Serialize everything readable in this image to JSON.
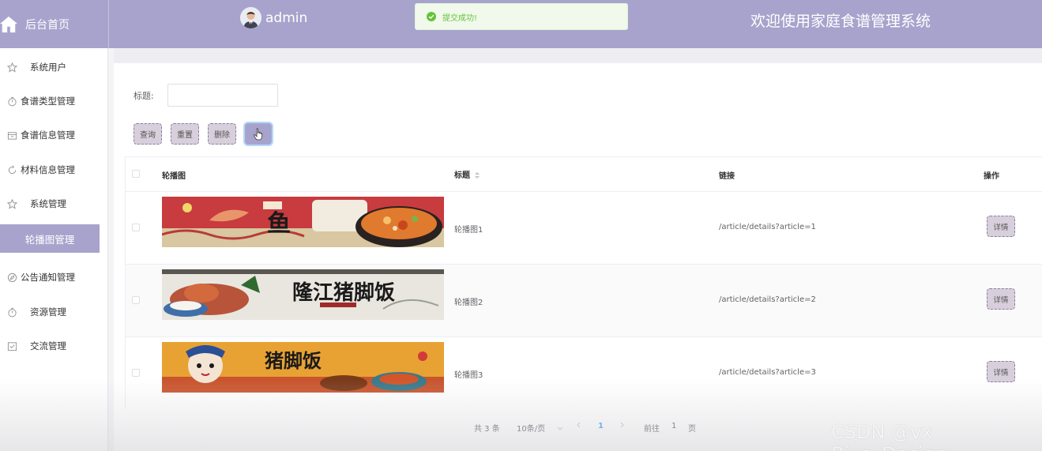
{
  "header": {
    "home_label": "后台首页",
    "user_name": "admin",
    "toast_message": "提交成功!",
    "system_title": "欢迎使用家庭食谱管理系统"
  },
  "sidebar": {
    "items": [
      {
        "label": "系统用户"
      },
      {
        "label": "食谱类型管理"
      },
      {
        "label": "食谱信息管理"
      },
      {
        "label": "材料信息管理"
      },
      {
        "label": "系统管理"
      },
      {
        "label": "轮播图管理",
        "active": true
      },
      {
        "label": "公告通知管理"
      },
      {
        "label": "资源管理"
      },
      {
        "label": "交流管理"
      }
    ]
  },
  "search": {
    "label": "标题:",
    "value": "",
    "placeholder": ""
  },
  "toolbar": {
    "query_label": "查询",
    "reset_label": "重置",
    "delete_label": "删除"
  },
  "table": {
    "headers": {
      "image": "轮播图",
      "title": "标题",
      "link": "链接",
      "action": "操作"
    },
    "rows": [
      {
        "title": "轮播图1",
        "link": "/article/details?article=1",
        "action": "详情",
        "banner_text": "鱼"
      },
      {
        "title": "轮播图2",
        "link": "/article/details?article=2",
        "action": "详情",
        "banner_text": "隆江猪脚饭"
      },
      {
        "title": "轮播图3",
        "link": "/article/details?article=3",
        "action": "详情",
        "banner_text": "猪脚饭"
      }
    ]
  },
  "pagination": {
    "total": "共 3 条",
    "page_size": "10条/页",
    "current_page": "1",
    "goto_prefix": "前往",
    "goto_value": "1",
    "goto_suffix": "页"
  },
  "watermark": "CSDN @vx Biye_Design",
  "colors": {
    "accent": "#a8a3cc",
    "success": "#67c23a",
    "link_active": "#409eff"
  }
}
